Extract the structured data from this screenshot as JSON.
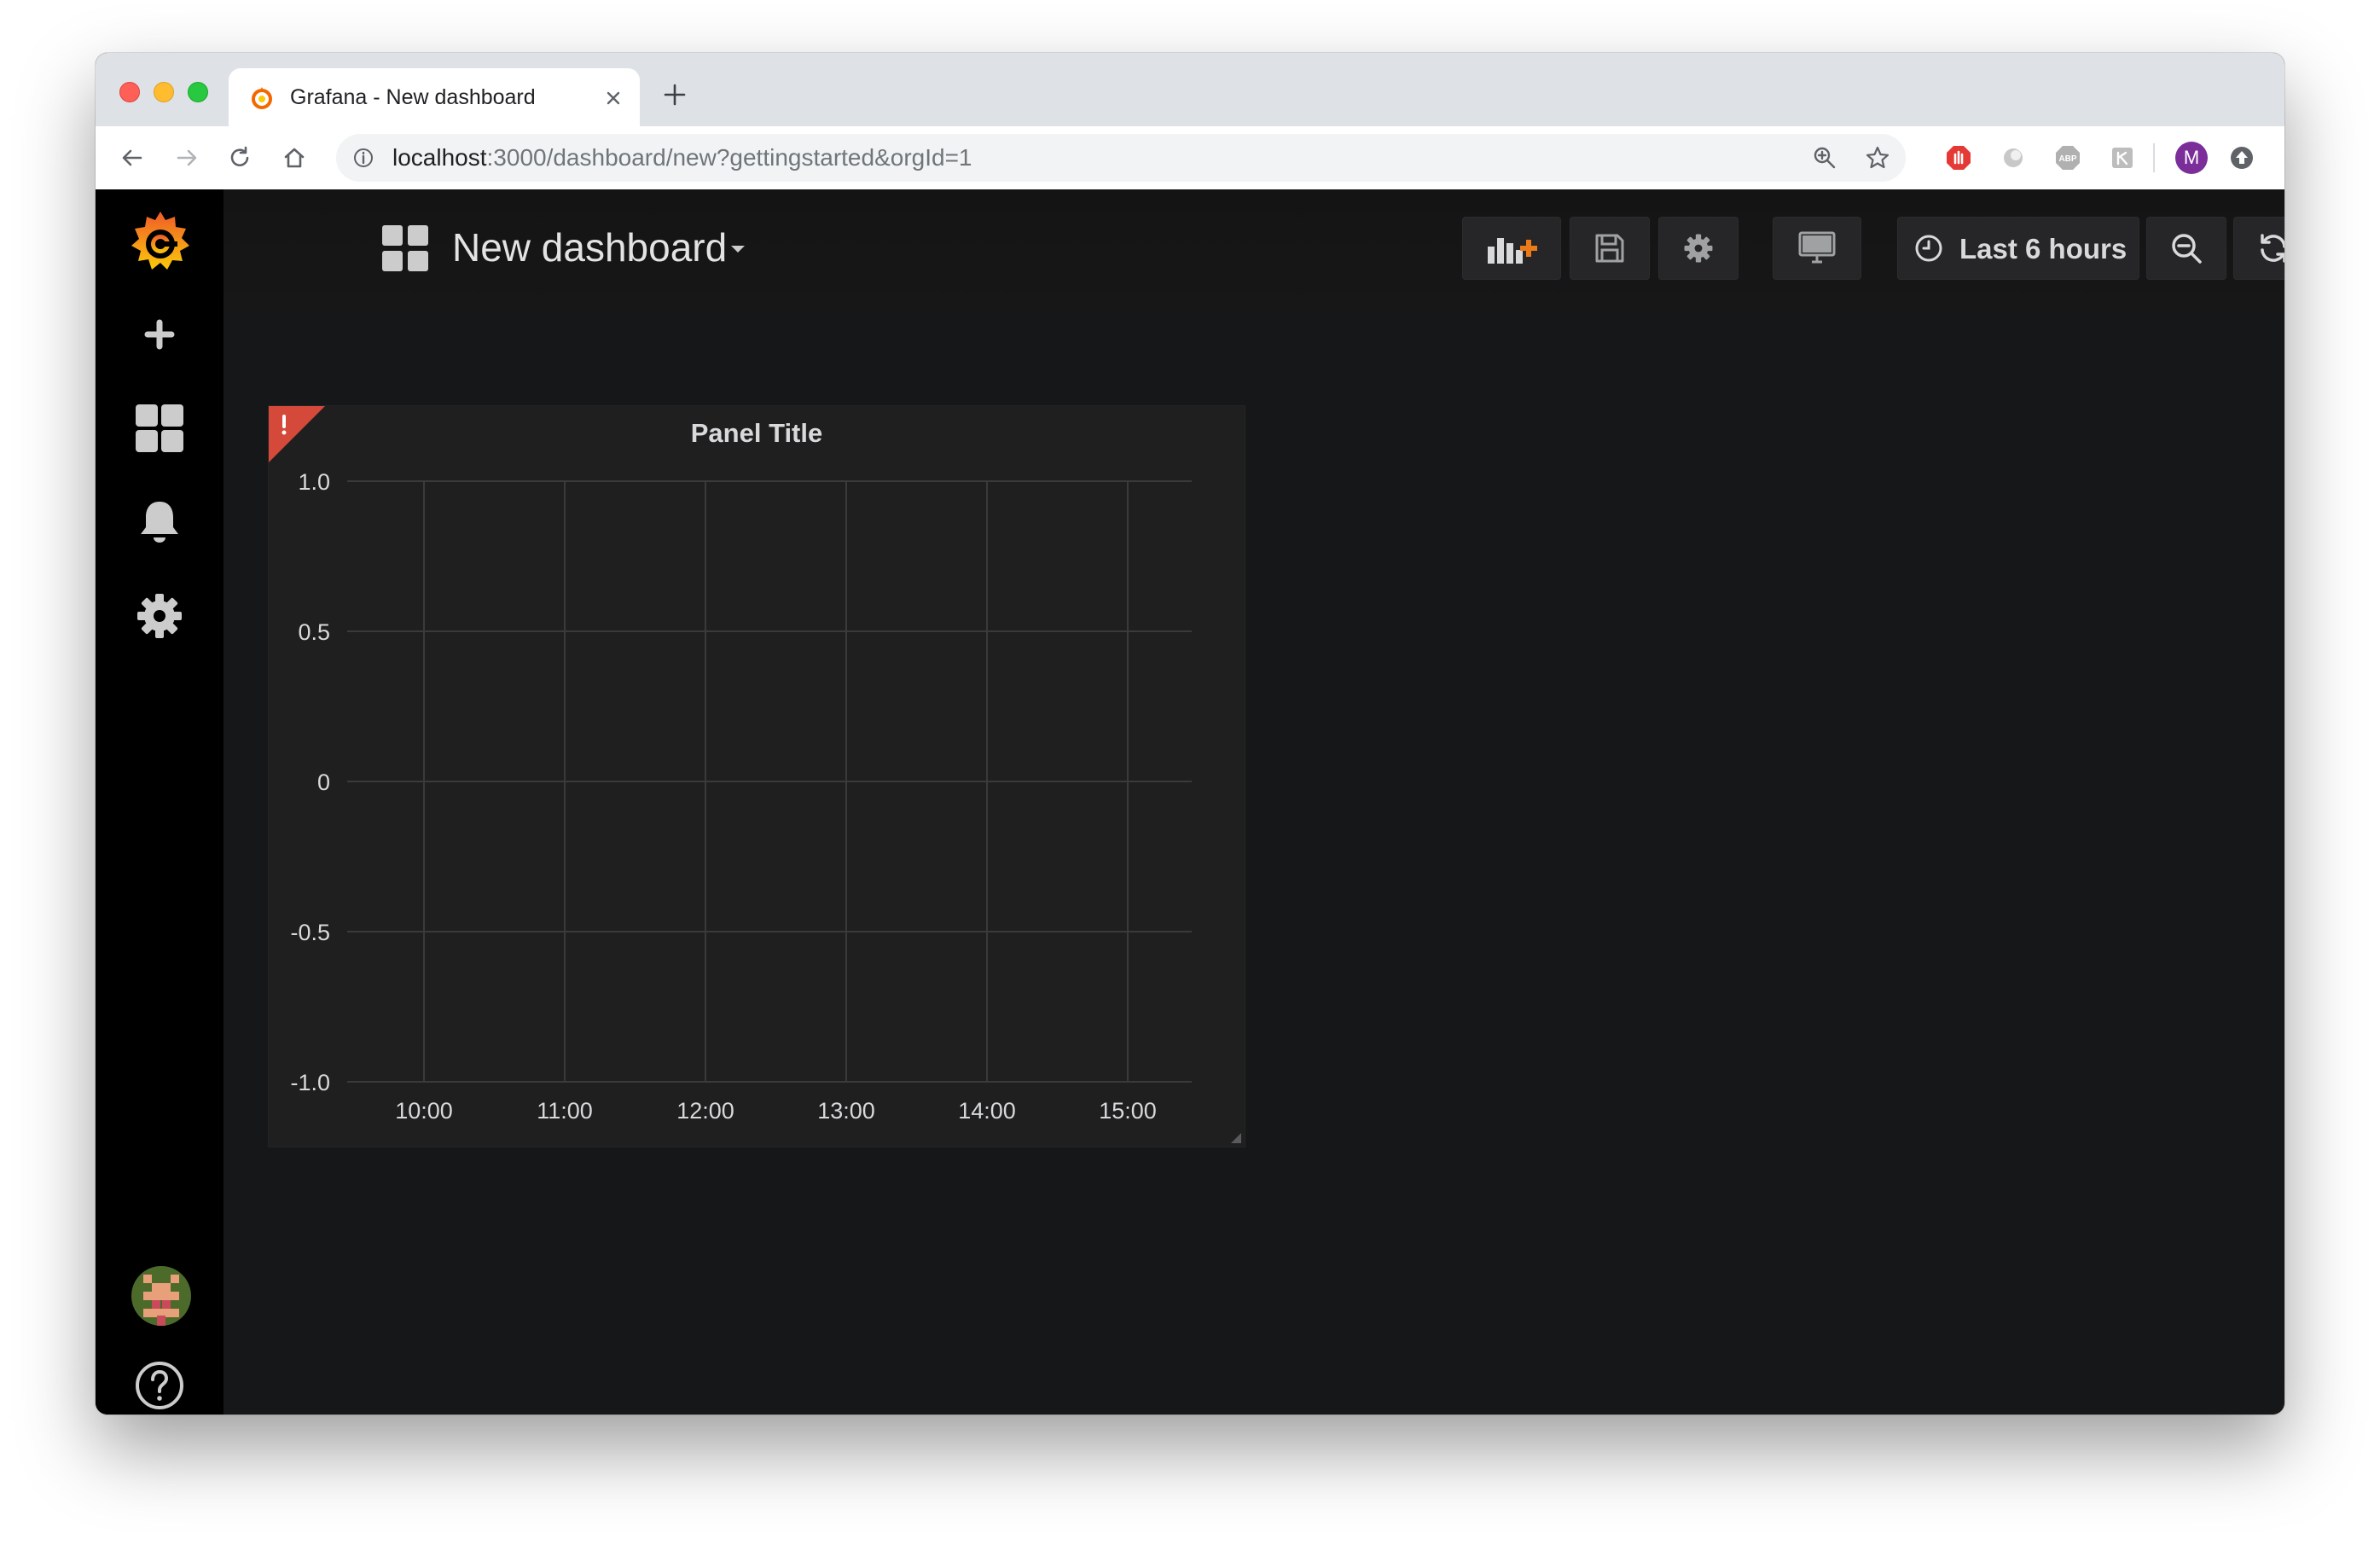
{
  "browser": {
    "tab_title": "Grafana - New dashboard",
    "url_host": "localhost",
    "url_rest": ":3000/dashboard/new?gettingstarted&orgId=1",
    "profile_initial": "M"
  },
  "navbar": {
    "dashboard_title": "New dashboard",
    "time_range": "Last 6 hours"
  },
  "panel": {
    "title": "Panel Title"
  },
  "chart_data": {
    "type": "line",
    "title": "Panel Title",
    "x": [
      "10:00",
      "11:00",
      "12:00",
      "13:00",
      "14:00",
      "15:00"
    ],
    "y_ticks": [
      "1.0",
      "0.5",
      "0",
      "-0.5",
      "-1.0"
    ],
    "ylim": [
      -1.0,
      1.0
    ],
    "series": [],
    "grid": true,
    "legend": "none"
  },
  "colors": {
    "accent": "#eb7b18",
    "panel_bg": "#1f1f20",
    "page_bg": "#161719",
    "alert_red": "#d44939",
    "grid": "#3a3a3c",
    "axis_text": "#d8d9da"
  },
  "icons": {
    "sidebar": [
      "grafana-logo-icon",
      "plus-icon",
      "dashboards-icon",
      "bell-icon",
      "gear-icon",
      "avatar",
      "help-icon"
    ],
    "toolbar": [
      "add-panel-icon",
      "save-icon",
      "gear-icon",
      "monitor-icon",
      "clock-icon",
      "zoom-out-icon",
      "refresh-icon"
    ]
  }
}
